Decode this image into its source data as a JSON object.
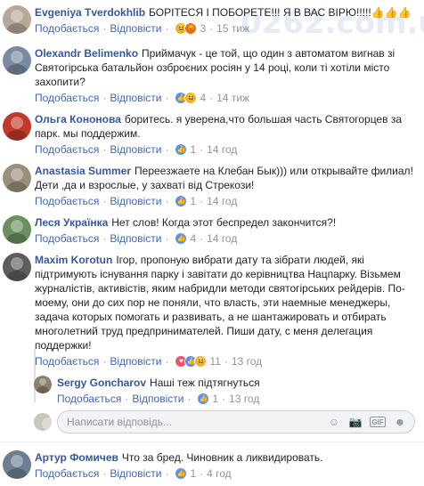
{
  "colors": {
    "link": "#4267b2",
    "name": "#365899",
    "meta": "#90949c"
  },
  "actions": {
    "like": "Подобається",
    "reply": "Відповісти"
  },
  "watermark": "0262.com.ua",
  "comments": [
    {
      "name": "Evgeniya Tverdokhlib",
      "text": "БОРІТЕСЯ І ПОБОРЕТЕ!!! Я В ВАС ВІРЮ!!!!!👍👍👍",
      "reactions": [
        "haha",
        "angry"
      ],
      "count": "3",
      "time": "15 тиж",
      "avatar_color": "#b8a89a"
    },
    {
      "name": "Olexandr Belimenko",
      "text": "Приймачук - це той, що один з автоматом вигнав зі Святогірська батальйон озброєних росіян у 14 році, коли ті хотіли місто захопити?",
      "reactions": [
        "like",
        "haha"
      ],
      "count": "4",
      "time": "14 тиж",
      "avatar_color": "#7a8aa0"
    },
    {
      "name": "Ольга Кононова",
      "text": "боритесь. я уверена,что большая часть Святогорцев за парк. мы поддержим.",
      "reactions": [
        "like"
      ],
      "count": "1",
      "time": "14 год",
      "avatar_color": "#c0392b"
    },
    {
      "name": "Anastasia Summer",
      "text": "Переезжаете на Клебан Бык))) или открывайте филиал! Дети ,да и взрослые, у захваті від Стрекози!",
      "reactions": [
        "like"
      ],
      "count": "1",
      "time": "14 год",
      "avatar_color": "#9a8e7c"
    },
    {
      "name": "Леся Українка",
      "text": "Нет слов! Когда этот беспредел закончится?!",
      "reactions": [
        "like"
      ],
      "count": "4",
      "time": "14 год",
      "avatar_color": "#6b8f5e"
    },
    {
      "name": "Maxim Korotun",
      "text": "Ігор, пропоную вибрати дату та зібрати людей, які підтримують існування парку і завітати до керівництва Нацпарку. Візьмем журналістів, активістів, яким набридли методи святогірських рейдерів. По-моему, они до сих пор не поняли, что власть, эти наемные менеджеры, задача которых помогать и развивать, а не шантажировать и отбирать многолетний труд предпринимателей. Пиши дату, с меня делегация поддержки!",
      "reactions": [
        "love",
        "like",
        "haha"
      ],
      "count": "11",
      "time": "13 год",
      "avatar_color": "#5d5d5d"
    }
  ],
  "reply": {
    "name": "Sergy Goncharov",
    "text": "Наші теж підтягнуться",
    "reactions": [
      "like"
    ],
    "count": "1",
    "time": "13 год",
    "avatar_color": "#8a7f70"
  },
  "composer": {
    "placeholder": "Написати відповідь...",
    "avatar_color": "#c9c4bc"
  },
  "last": {
    "name": "Артур Фомичев",
    "text": "Что за бред. Чиновник а ликвидировать.",
    "reactions": [
      "like"
    ],
    "count": "1",
    "time": "4 год",
    "avatar_color": "#6d7e93"
  }
}
